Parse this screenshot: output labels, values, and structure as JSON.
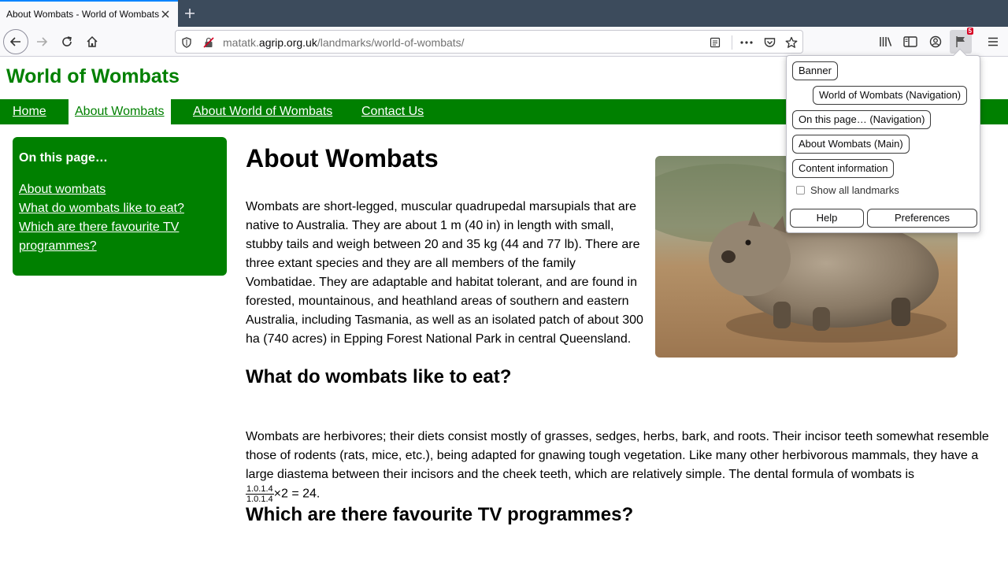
{
  "browser": {
    "tab_title": "About Wombats - World of Wombats",
    "url_host_prefix": "matatk.",
    "url_host_domain": "agrip.org.uk",
    "url_path": "/landmarks/world-of-wombats/",
    "extension_badge": "5",
    "icons": {
      "tab_close": "close-icon",
      "new_tab": "plus-icon",
      "back": "back-arrow-icon",
      "forward": "forward-arrow-icon",
      "reload": "reload-icon",
      "home": "home-icon",
      "tracking": "shield-icon",
      "insecure": "insecure-lock-icon",
      "reader": "reader-view-icon",
      "more": "more-dots-icon",
      "pocket": "pocket-icon",
      "bookmark": "star-icon",
      "library": "library-icon",
      "sidebar": "sidebar-icon",
      "account": "account-icon",
      "landmarks": "landmarks-flag-icon",
      "menu": "hamburger-menu-icon"
    }
  },
  "site": {
    "title": "World of Wombats",
    "accent_color": "#008000",
    "nav": [
      {
        "label": "Home",
        "current": false
      },
      {
        "label": "About Wombats",
        "current": true
      },
      {
        "label": "About World of Wombats",
        "current": false
      },
      {
        "label": "Contact Us",
        "current": false
      }
    ]
  },
  "sidebar": {
    "heading": "On this page…",
    "links": [
      "About wombats",
      "What do wombats like to eat?",
      "Which are there favourite TV programmes?"
    ]
  },
  "main": {
    "heading": "About Wombats",
    "intro": "Wombats are short-legged, muscular quadrupedal marsupials that are native to Australia. They are about 1 m (40 in) in length with small, stubby tails and weigh between 20 and 35 kg (44 and 77 lb). There are three extant species and they are all members of the family Vombatidae. They are adaptable and habitat tolerant, and are found in forested, mountainous, and heathland areas of southern and eastern Australia, including Tasmania, as well as an isolated patch of about 300 ha (740 acres) in Epping Forest National Park in central Queensland.",
    "section2_heading": "What do wombats like to eat?",
    "section2_text": "Wombats are herbivores; their diets consist mostly of grasses, sedges, herbs, bark, and roots. Their incisor teeth somewhat resemble those of rodents (rats, mice, etc.), being adapted for gnawing tough vegetation. Like many other herbivorous mammals, they have a large diastema between their incisors and the cheek teeth, which are relatively simple. The dental formula of wombats is",
    "formula_numerator": "1.0.1.4",
    "formula_denominator": "1.0.1.4",
    "formula_rest": "×2 = 24.",
    "section3_heading": "Which are there favourite TV programmes?"
  },
  "landmarks_popup": {
    "items": [
      "Banner",
      "World of Wombats (Navigation)",
      "On this page… (Navigation)",
      "About Wombats (Main)",
      "Content information"
    ],
    "show_all_label": "Show all landmarks",
    "show_all_checked": false,
    "help_label": "Help",
    "preferences_label": "Preferences"
  }
}
